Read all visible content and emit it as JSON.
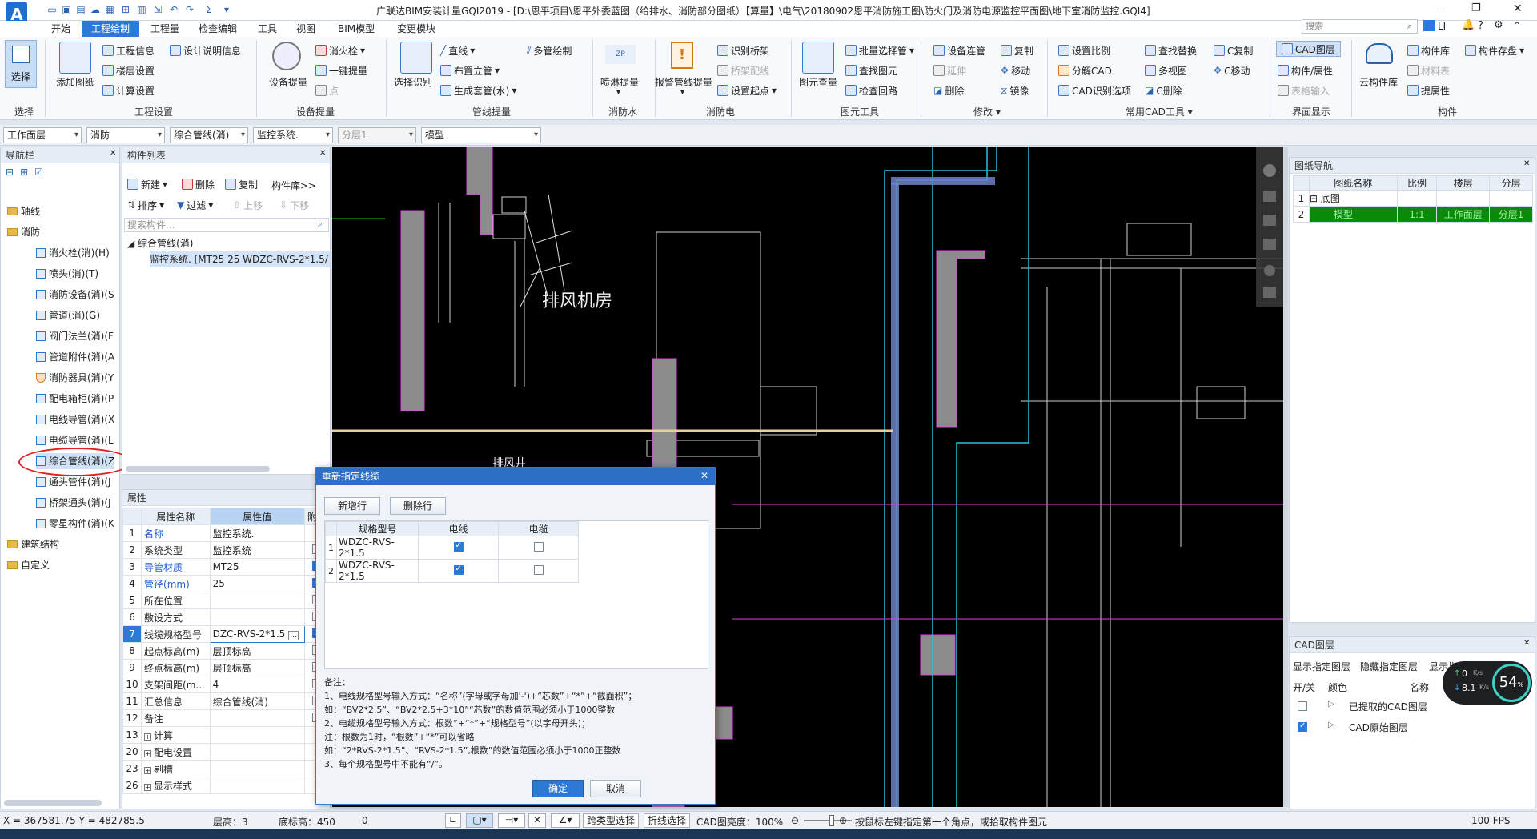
{
  "app": {
    "logo": "A",
    "title": "广联达BIM安装计量GQI2019 - [D:\\恩平项目\\恩平外委蓝图（给排水、消防部分图纸）【算量】\\电气\\20180902恩平消防施工图\\防火门及消防电源监控平面图\\地下室消防监控.GQI4]"
  },
  "menus": [
    "开始",
    "工程绘制",
    "工程量",
    "检查编辑",
    "工具",
    "视图",
    "BIM模型",
    "变更模块"
  ],
  "active_menu": "工程绘制",
  "search_placeholder": "搜索",
  "user": "LI",
  "ribbon": {
    "select": "选择",
    "select_group": "选择",
    "add_drawing": "添加图纸",
    "project_info": "工程信息",
    "design_desc": "设计说明信息",
    "floor_setting": "楼层设置",
    "calc_setting": "计算设置",
    "g_project": "工程设置",
    "device_extract": "设备提量",
    "hydrant": "消火栓",
    "one_key": "一键提量",
    "point": "点",
    "g_device": "设备提量",
    "select_recog": "选择识别",
    "line": "直线",
    "riser": "布置立管",
    "gen_sleeve": "生成套管(水)",
    "multi_pipe": "多管绘制",
    "g_pipe": "管线提量",
    "sprinkler": "喷淋提量",
    "g_sprinkler": "消防水",
    "alarm": "报警管线提量",
    "recog_bridge": "识别桥架",
    "bridge_wire": "桥架配线",
    "set_start": "设置起点",
    "g_elec": "消防电",
    "elem_check": "图元查量",
    "batch_select": "批量选择管",
    "find_elem": "查找图元",
    "check_loop": "检查回路",
    "g_elem": "图元工具",
    "dev_connect": "设备连管",
    "extend": "延伸",
    "delete": "删除",
    "copy": "复制",
    "move": "移动",
    "mirror": "镜像",
    "g_modify": "修改",
    "set_scale": "设置比例",
    "split_cad": "分解CAD",
    "cad_opt": "CAD识别选项",
    "find_replace": "查找替换",
    "multi_view": "多视图",
    "c_delete": "C删除",
    "c_copy": "C复制",
    "c_move": "C移动",
    "g_cad": "常用CAD工具",
    "cad_layer": "CAD图层",
    "comp_attr": "构件/属性",
    "table_input": "表格输入",
    "g_ui": "界面显示",
    "cloud_lib": "云构件库",
    "comp_lib": "构件库",
    "material": "材料表",
    "extract_attr": "提属性",
    "comp_save": "构件存盘",
    "g_comp": "构件"
  },
  "combos": [
    "工作面层",
    "消防",
    "综合管线(消)",
    "监控系统.",
    "分层1",
    "模型"
  ],
  "nav": {
    "title": "导航栏",
    "items": [
      "轴线",
      "消防",
      "消火栓(消)(H)",
      "喷头(消)(T)",
      "消防设备(消)(S",
      "管道(消)(G)",
      "阀门法兰(消)(F",
      "管道附件(消)(A",
      "消防器具(消)(Y",
      "配电箱柜(消)(P",
      "电线导管(消)(X",
      "电缆导管(消)(L",
      "综合管线(消)(Z",
      "通头管件(消)(J",
      "桥架通头(消)(J",
      "零星构件(消)(K",
      "建筑结构",
      "自定义"
    ]
  },
  "comp_list": {
    "title": "构件列表",
    "new": "新建",
    "delete": "删除",
    "copy": "复制",
    "lib": "构件库>>",
    "sort": "排序",
    "filter": "过滤",
    "up": "上移",
    "down": "下移",
    "search_placeholder": "搜索构件...",
    "tree_root": "综合管线(消)",
    "tree_item": "监控系统. [MT25 25 WDZC-RVS-2*1.5/"
  },
  "props": {
    "title": "属性",
    "h_name": "属性名称",
    "h_value": "属性值",
    "h_add": "附加",
    "rows": [
      {
        "n": "1",
        "name": "名称",
        "value": "监控系统.",
        "blue": true,
        "cb": null
      },
      {
        "n": "2",
        "name": "系统类型",
        "value": "监控系统",
        "blue": false,
        "cb": false
      },
      {
        "n": "3",
        "name": "导管材质",
        "value": "MT25",
        "blue": true,
        "cb": true
      },
      {
        "n": "4",
        "name": "管径(mm)",
        "value": "25",
        "blue": true,
        "cb": true
      },
      {
        "n": "5",
        "name": "所在位置",
        "value": "",
        "blue": false,
        "cb": false
      },
      {
        "n": "6",
        "name": "敷设方式",
        "value": "",
        "blue": false,
        "cb": false
      },
      {
        "n": "7",
        "name": "线缆规格型号",
        "value": "DZC-RVS-2*1.5",
        "blue": false,
        "cb": true
      },
      {
        "n": "8",
        "name": "起点标高(m)",
        "value": "层顶标高",
        "blue": false,
        "cb": false
      },
      {
        "n": "9",
        "name": "终点标高(m)",
        "value": "层顶标高",
        "blue": false,
        "cb": false
      },
      {
        "n": "10",
        "name": "支架间距(m...",
        "value": "4",
        "blue": false,
        "cb": false
      },
      {
        "n": "11",
        "name": "汇总信息",
        "value": "综合管线(消)",
        "blue": false,
        "cb": false
      },
      {
        "n": "12",
        "name": "备注",
        "value": "",
        "blue": false,
        "cb": false
      },
      {
        "n": "13",
        "name": "计算",
        "value": "",
        "blue": false,
        "cb": null,
        "plus": true
      },
      {
        "n": "20",
        "name": "配电设置",
        "value": "",
        "blue": false,
        "cb": null,
        "plus": true
      },
      {
        "n": "23",
        "name": "剔槽",
        "value": "",
        "blue": false,
        "cb": null,
        "plus": true
      },
      {
        "n": "26",
        "name": "显示样式",
        "value": "",
        "blue": false,
        "cb": null,
        "plus": true
      }
    ]
  },
  "canvas": {
    "label1": "排风机房",
    "label2": "排风井"
  },
  "dialog": {
    "title": "重新指定线缆",
    "add_row": "新增行",
    "del_row": "删除行",
    "h_spec": "规格型号",
    "h_wire": "电线",
    "h_cable": "电缆",
    "rows": [
      {
        "n": "1",
        "spec": "WDZC-RVS-2*1.5",
        "wire": true,
        "cable": false
      },
      {
        "n": "2",
        "spec": "WDZC-RVS-2*1.5",
        "wire": true,
        "cable": false
      }
    ],
    "notes": [
      "备注：",
      "1、电线规格型号输入方式：“名称”(字母或字母加'-')+“芯数”+“*”+“截面积”；",
      "如：“BV2*2.5”、“BV2*2.5+3*10”“芯数”的数值范围必须小于1000整数",
      "2、电缆规格型号输入方式：根数”+“*”+“规格型号”(以字母开头)；",
      "注：根数为1时，“根数”+“*”可以省略",
      "如：“2*RVS-2*1.5”、“RVS-2*1.5”,根数”的数值范围必须小于1000正整数",
      "3、每个规格型号中不能有“/”。"
    ],
    "ok": "确定",
    "cancel": "取消"
  },
  "drawing_nav": {
    "title": "图纸导航",
    "h_name": "图纸名称",
    "h_scale": "比例",
    "h_floor": "楼层",
    "h_layer": "分层",
    "rows": [
      {
        "n": "1",
        "name": "底图",
        "scale": "",
        "floor": "",
        "layer": ""
      },
      {
        "n": "2",
        "name": "模型",
        "scale": "1:1",
        "floor": "工作面层",
        "layer": "分层1"
      }
    ]
  },
  "cad_layers": {
    "title": "CAD图层",
    "show_sel": "显示指定图层",
    "hide_sel": "隐藏指定图层",
    "show_only": "显示指定图元",
    "h_onoff": "开/关",
    "h_color": "颜色",
    "h_name": "名称",
    "rows": [
      {
        "name": "已提取的CAD图层",
        "on": false
      },
      {
        "name": "CAD原始图层",
        "on": true
      }
    ]
  },
  "net": {
    "up": "0",
    "down": "8.1",
    "unit": "K/s",
    "pct": "54",
    "pct_unit": "%"
  },
  "status": {
    "coords": "X = 367581.75 Y = 482785.5",
    "floor_h": "层高：3",
    "base_h": "底标高：450",
    "zero": "0",
    "cross_type": "跨类型选择",
    "polyline": "折线选择",
    "brightness": "CAD图亮度：100%",
    "hint": "按鼠标左键指定第一个角点，或拾取构件图元",
    "fps": "100 FPS"
  },
  "colors": {
    "accent": "#2b7ad8",
    "selected_row": "#0a8a0a",
    "pink": "#e040e0",
    "cyan": "#29c3d6",
    "gray": "#8c8c8c"
  }
}
